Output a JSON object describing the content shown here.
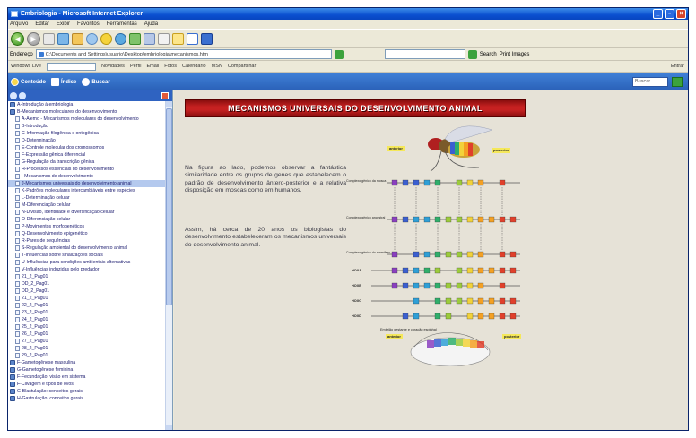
{
  "window": {
    "title": "Embriologia - Microsoft Internet Explorer",
    "controls": {
      "minimize": "_",
      "maximize": "▫",
      "close": "×"
    }
  },
  "menu": [
    "Arquivo",
    "Editar",
    "Exibir",
    "Favoritos",
    "Ferramentas",
    "Ajuda"
  ],
  "address": {
    "label": "Endereço",
    "url": "C:\\Documents and Settings\\usuario\\Desktop\\embriologia\\mecanismos.htm",
    "search_label": "Search",
    "links": [
      "Print Images"
    ]
  },
  "linksbar": {
    "items": [
      "Windows Live",
      "Novidades",
      "Perfil",
      "Email",
      "Fotos",
      "Calendário",
      "MSN",
      "Compartilhar"
    ],
    "right": "Entrar"
  },
  "sitenav": {
    "items": [
      "Conteúdo",
      "Índice",
      "Buscar"
    ],
    "search_placeholder": "Buscar"
  },
  "sidebar": {
    "items": [
      {
        "label": "A-Introdução à embriologia",
        "level": 0
      },
      {
        "label": "B-Mecanismos moleculares do desenvolvimento",
        "level": 0
      },
      {
        "label": "A-Alemo - Mecanismos moleculares do desenvolvimento",
        "level": 1
      },
      {
        "label": "B-Introdução",
        "level": 1
      },
      {
        "label": "C-Informação filogênica e ontogênica",
        "level": 1
      },
      {
        "label": "D-Determinação",
        "level": 1
      },
      {
        "label": "E-Controle molecular dos cromossomos",
        "level": 1
      },
      {
        "label": "F-Expressão gênica diferencial",
        "level": 1
      },
      {
        "label": "G-Regulação da transcrição gênica",
        "level": 1
      },
      {
        "label": "H-Processos essenciais do desenvolvimento",
        "level": 1
      },
      {
        "label": "I-Mecanismos de desenvolvimento",
        "level": 1
      },
      {
        "label": "J-Mecanismos universais do desenvolvimento animal",
        "level": 1,
        "selected": true
      },
      {
        "label": "K-Padrões moleculares intercambiáveis entre espécies",
        "level": 1
      },
      {
        "label": "L-Determinação celular",
        "level": 1
      },
      {
        "label": "M-Diferenciação celular",
        "level": 1
      },
      {
        "label": "N-Divisão, Identidade e diversificação celular",
        "level": 1
      },
      {
        "label": "O-Diferenciação celular",
        "level": 1
      },
      {
        "label": "P-Movimentos morfogenéticos",
        "level": 1
      },
      {
        "label": "Q-Desenvolvimento epigenético",
        "level": 1
      },
      {
        "label": "R-Pares de sequências",
        "level": 1
      },
      {
        "label": "S-Regulação ambiental do desenvolvimento animal",
        "level": 1
      },
      {
        "label": "T-Influências sobre sinalizações sociais",
        "level": 1
      },
      {
        "label": "U-Influências para condições ambientais alternativas",
        "level": 1
      },
      {
        "label": "V-Influências induzidas pelo predador",
        "level": 1
      },
      {
        "label": "21_2_Pag01",
        "level": 1
      },
      {
        "label": "DD_2_Pag01",
        "level": 1
      },
      {
        "label": "DD_2_Pag01",
        "level": 1
      },
      {
        "label": "21_2_Pag01",
        "level": 1
      },
      {
        "label": "22_2_Pag01",
        "level": 1
      },
      {
        "label": "23_2_Pag01",
        "level": 1
      },
      {
        "label": "24_2_Pag01",
        "level": 1
      },
      {
        "label": "25_2_Pag01",
        "level": 1
      },
      {
        "label": "26_2_Pag01",
        "level": 1
      },
      {
        "label": "27_2_Pag01",
        "level": 1
      },
      {
        "label": "28_2_Pag01",
        "level": 1
      },
      {
        "label": "29_2_Pag01",
        "level": 1
      },
      {
        "label": "F-Gametogênese masculina",
        "level": 0
      },
      {
        "label": "G-Gametogênese feminina",
        "level": 0
      },
      {
        "label": "F-Fecundação: visão em sistema",
        "level": 0
      },
      {
        "label": "F-Clivagem e tipos de ovos",
        "level": 0
      },
      {
        "label": "G-Blastulação: conceitos gerais",
        "level": 0
      },
      {
        "label": "H-Gastrulação: conceitos gerais",
        "level": 0
      }
    ]
  },
  "main": {
    "title": "MECANISMOS UNIVERSAIS DO DESENVOLVIMENTO ANIMAL",
    "paragraph1": "Na figura ao lado, podemos observar a fantástica similaridade entre os grupos de genes que estabelecem o padrão de desenvolvimento ântero-posterior e a relativa disposição em moscas como em humanos.",
    "paragraph2": "Assim, há cerca de 20 anos os biologistas do desenvolvimento estabeleceram os mecanismos universais do desenvolvimento animal."
  },
  "figure": {
    "labels": {
      "fly_anterior": "anterior",
      "fly_posterior": "posterior",
      "mouse_anterior": "anterior",
      "mouse_posterior": "posterior"
    },
    "row_labels": [
      "Complexo gênico da mosca",
      "Complexo gênico ancestral",
      "Complexo gênico do mamífero"
    ],
    "hox_labels": [
      "HOXA",
      "HOXB",
      "HOXC",
      "HOXD"
    ],
    "mouse_caption": "Embrião gestante e coração espinhal",
    "colors": [
      "#8a3fbf",
      "#3b5fd0",
      "#2e9fd6",
      "#2fae6b",
      "#9ccb3b",
      "#f2d23a",
      "#f4a023",
      "#e0402b"
    ]
  }
}
